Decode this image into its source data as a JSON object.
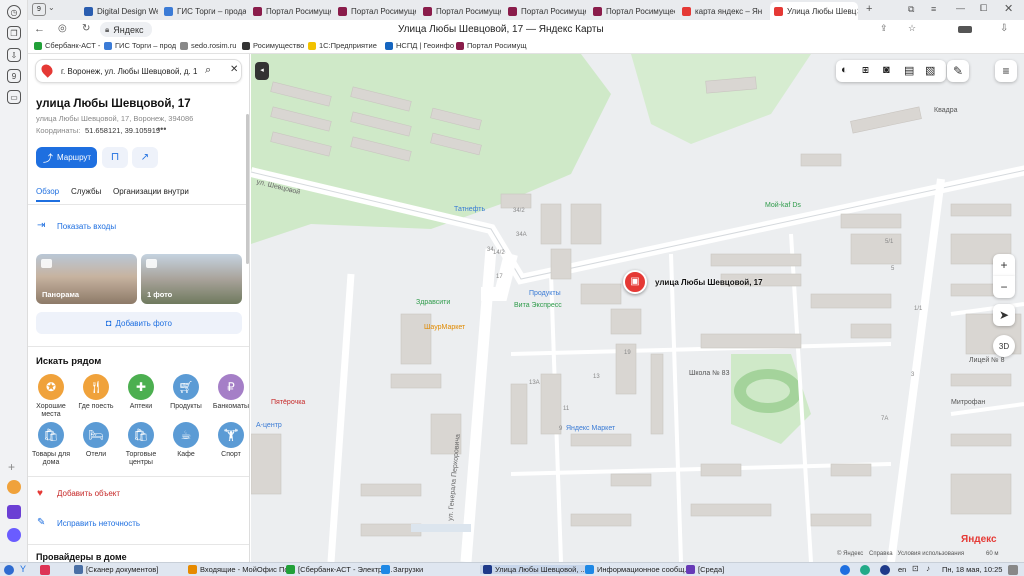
{
  "browser": {
    "tab_count": "9",
    "tabs": [
      {
        "label": "Digital Design Web",
        "color": "#2a5db0"
      },
      {
        "label": "ГИС Торги – прода",
        "color": "#3b7bd6"
      },
      {
        "label": "Портал Росимущес",
        "color": "#8a1c4a"
      },
      {
        "label": "Портал Росимущес",
        "color": "#8a1c4a"
      },
      {
        "label": "Портал Росимущес",
        "color": "#8a1c4a"
      },
      {
        "label": "Портал Росимущес",
        "color": "#8a1c4a"
      },
      {
        "label": "Портал Росимущес",
        "color": "#8a1c4a"
      },
      {
        "label": "карта яндекс – Ян",
        "color": "#e53935"
      },
      {
        "label": "Улица Любы Шевц",
        "color": "#e53935"
      }
    ],
    "address_text": "Яндекс",
    "page_title": "Улица Любы Шевцовой, 17 — Яндекс Карты",
    "bookmarks": [
      {
        "label": "Сбербанк-АСТ -",
        "color": "#21a038"
      },
      {
        "label": "ГИС Торги – прод",
        "color": "#3b7bd6"
      },
      {
        "label": "sedo.rosim.ru",
        "color": "#888888"
      },
      {
        "label": "Росимущество",
        "color": "#333333"
      },
      {
        "label": "1С:Предприятие",
        "color": "#f2c200"
      },
      {
        "label": "НСПД | Геоинфо",
        "color": "#1565c0"
      },
      {
        "label": "Портал Росимущ",
        "color": "#8a1c4a"
      }
    ]
  },
  "panel": {
    "search_value": "г. Воронеж, ул. Любы Шевцовой, д. 1",
    "title": "улица Любы Шевцовой, 17",
    "subtitle": "улица Любы Шевцовой, 17, Воронеж, 394086",
    "coords_label": "Координаты:",
    "coords_value": "51.658121, 39.105919",
    "route_label": "Маршрут",
    "tabs": [
      "Обзор",
      "Службы",
      "Организации внутри"
    ],
    "show_entrances": "Показать входы",
    "panorama_label": "Панорама",
    "photo_label": "1 фото",
    "add_photo": "Добавить фото",
    "nearby_title": "Искать рядом",
    "categories": [
      {
        "label": "Хорошие места",
        "color": "#f0a23b"
      },
      {
        "label": "Где поесть",
        "color": "#f0a23b"
      },
      {
        "label": "Аптеки",
        "color": "#4caf50"
      },
      {
        "label": "Продукты",
        "color": "#5b9bd5"
      },
      {
        "label": "Банкоматы",
        "color": "#a57fc7"
      },
      {
        "label": "Товары для дома",
        "color": "#5b9bd5"
      },
      {
        "label": "Отели",
        "color": "#5b9bd5"
      },
      {
        "label": "Торговые центры",
        "color": "#5b9bd5"
      },
      {
        "label": "Кафе",
        "color": "#5b9bd5"
      },
      {
        "label": "Спорт",
        "color": "#5b9bd5"
      }
    ],
    "add_object": "Добавить объект",
    "fix_error": "Исправить неточность",
    "providers_title": "Провайдеры в доме"
  },
  "map": {
    "marker_label": "улица Любы Шевцовой, 17",
    "labels": {
      "tatneft": "Татнефть",
      "zdravsiti": "Здравсити",
      "vita": "Вита Экспресс",
      "produkty": "Продукты",
      "shaurma": "ШаурМаркет",
      "pyaterochka": "Пятёрочка",
      "yandex_market": "Яндекс Маркет",
      "school": "Школа № 83",
      "moy_kafe": "Мой-kaf Ds",
      "kvadra": "Квадра",
      "a_centr": "А-центр",
      "street_shevtsovoy": "ул. Шевцовой",
      "street_general": "ул. Генерала Перхоровича",
      "lyceum": "Лицей № 8",
      "mitrofan": "Митрофан"
    },
    "house_numbers": [
      "34/2",
      "34А",
      "34",
      "14/2",
      "17",
      "19",
      "13",
      "13А",
      "11",
      "9",
      "5/1",
      "5",
      "1/1",
      "3",
      "7А"
    ],
    "button_3d": "3D",
    "copyright": "© Яндекс",
    "footer_links": "Справка   Условия использования",
    "brand": "Яндекс",
    "scale": "60 м"
  },
  "taskbar": {
    "items": [
      {
        "label": "[Сканер документов]",
        "color": "#4a6fa5"
      },
      {
        "label": "Входящие - МойОфис По...",
        "color": "#e68a00"
      },
      {
        "label": "[Сбербанк-АСТ - Электро...",
        "color": "#21a038"
      },
      {
        "label": "Загрузки",
        "color": "#1e88e5"
      },
      {
        "label": "Улица Любы Шевцовой, ...",
        "color": "#1e3a8a"
      },
      {
        "label": "Информационное сообщ...",
        "color": "#1e88e5"
      },
      {
        "label": "[Среда]",
        "color": "#673ab7"
      }
    ],
    "lang": "en",
    "clock": "Пн, 18 мая, 10:25"
  }
}
